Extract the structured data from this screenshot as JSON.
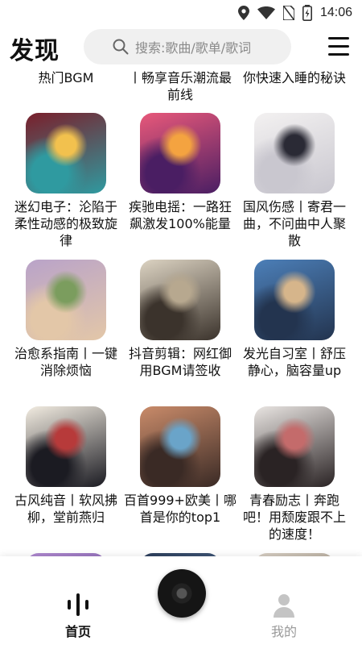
{
  "status_bar": {
    "time": "14:06",
    "icons": [
      "location-icon",
      "wifi-icon",
      "no-sim-icon",
      "battery-icon"
    ]
  },
  "header": {
    "title": "发现",
    "search_placeholder": "搜索:歌曲/歌单/歌词"
  },
  "top_partial_captions": [
    "热门BGM",
    "丨畅享音乐潮流最前线",
    "你快速入睡的秘诀"
  ],
  "playlists": [
    {
      "title": "迷幻电子：沦陷于柔性动感的极致旋律",
      "colors": [
        "#7a1f2b",
        "#2f9aa0",
        "#f2c14e"
      ]
    },
    {
      "title": "疾驰电摇：一路狂飙激发100%能量",
      "colors": [
        "#e8587a",
        "#4a1e63",
        "#f4a340"
      ]
    },
    {
      "title": "国风伤感丨寄君一曲，不问曲中人聚散",
      "colors": [
        "#f3f1f1",
        "#c9c7cf",
        "#2a2a35"
      ]
    },
    {
      "title": "治愈系指南丨一键消除烦恼",
      "colors": [
        "#b9a3c9",
        "#e3c7a8",
        "#7b9d5e"
      ]
    },
    {
      "title": "抖音剪辑：网红御用BGM请签收",
      "colors": [
        "#dcd3c2",
        "#3b332c",
        "#b7a88f"
      ]
    },
    {
      "title": "发光自习室丨舒压静心，脑容量up",
      "colors": [
        "#4c7fb8",
        "#23344f",
        "#d6b58b"
      ]
    },
    {
      "title": "古风纯音丨软风拂柳，堂前燕归",
      "colors": [
        "#f2ece1",
        "#1b1b22",
        "#b73a3a"
      ]
    },
    {
      "title": "百首999+欧美丨哪首是你的top1",
      "colors": [
        "#c98b6a",
        "#3a2a25",
        "#6aa4c9"
      ]
    },
    {
      "title": "青春励志丨奔跑吧！用颓废跟不上的速度！",
      "colors": [
        "#e9e5e2",
        "#2a2324",
        "#c46b6b"
      ]
    },
    {
      "title": "",
      "colors": [
        "#b08ad0",
        "#5b3e8f",
        "#e7d2f2"
      ]
    },
    {
      "title": "",
      "colors": [
        "#2b3d5a",
        "#6a8db5",
        "#1a1f2b"
      ]
    },
    {
      "title": "",
      "colors": [
        "#d7cfc4",
        "#7a6a55",
        "#c9b49a"
      ]
    }
  ],
  "tab_bar": {
    "home_label": "首页",
    "me_label": "我的",
    "home_active": true
  }
}
